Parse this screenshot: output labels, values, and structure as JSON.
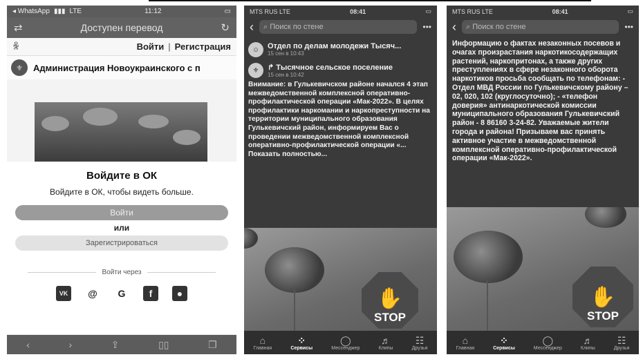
{
  "phone1": {
    "status": {
      "carrier": "◂ WhatsApp",
      "network": "LTE",
      "time": "11:12"
    },
    "toolbar": {
      "title": "Доступен перевод"
    },
    "auth": {
      "login": "Войти",
      "separator": "|",
      "register": "Регистрация"
    },
    "group_name": "Администрация Новоукраинского с п",
    "modal": {
      "title": "Войдите в ОК",
      "subtitle": "Войдите в ОК, чтобы видеть больше.",
      "login_button": "Войти",
      "or": "или",
      "register_button": "Зарегистрироваться",
      "via": "Войти через"
    },
    "social": [
      "VK",
      "@",
      "G",
      "f",
      ""
    ]
  },
  "phone2": {
    "status": {
      "carrier": "MTS RUS",
      "network": "LTE",
      "time": "08:41"
    },
    "search_placeholder": "Поиск по стене",
    "post1": {
      "author": "Отдел по делам молодежи Тысяч...",
      "date": "15 сен в 10:43"
    },
    "post2": {
      "author": "Тысячное сельское поселение",
      "date": "15 сен в 10:42"
    },
    "text": "Внимание: в Гулькевичском районе начался 4 этап межведомственной комплексной оперативно-профилактической операции «Мак-2022». В целях профилактики наркомании и наркопреступности на территории муниципального образования Гулькевичский район, информируем Вас о проведении межведомственной комплексной оперативно-профилактической операции «... Показать полностью...",
    "stop_label": "STOP",
    "nav": [
      "Главная",
      "Сервисы",
      "Мессенджер",
      "Клипы",
      "Друзья"
    ]
  },
  "phone3": {
    "status": {
      "carrier": "MTS RUS",
      "network": "LTE",
      "time": "08:41"
    },
    "search_placeholder": "Поиск по стене",
    "text": "Информацию о фактах незаконных посевов и очагах произрастания наркотикосодержащих растений, наркопритонах, а также других преступлениях в сфере незаконного оборота наркотиков просьба сообщать по телефонам: - Отдел МВД России по Гулькевичскому району – 02, 020, 102 (круглосуточно); - «телефон доверия» антинаркотической комиссии муниципального образования Гулькевичский район - 8 86160 3-24-82. Уважаемые жители города и района! Призываем вас принять активное участие в межведомственной комплексной оперативно-профилактической операции «Мак-2022».",
    "stop_label": "STOP",
    "nav": [
      "Главная",
      "Сервисы",
      "Мессенджер",
      "Клипы",
      "Друзья"
    ]
  }
}
